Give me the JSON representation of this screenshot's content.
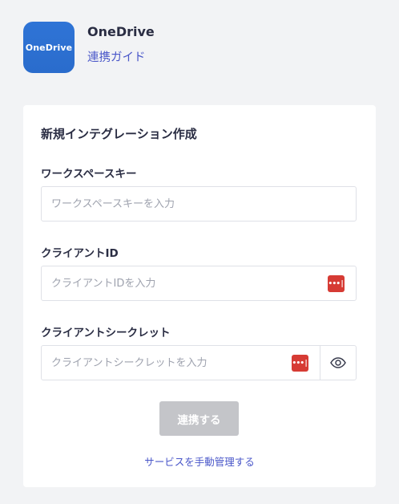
{
  "app": {
    "logo_text": "OneDrive",
    "name": "OneDrive",
    "guide_link": "連携ガイド",
    "colors": {
      "logo_bg": "#2f74d6",
      "link": "#4a57c9"
    }
  },
  "form": {
    "title": "新規インテグレーション作成",
    "workspace_key": {
      "label": "ワークスペースキー",
      "placeholder": "ワークスペースキーを入力",
      "value": ""
    },
    "client_id": {
      "label": "クライアントID",
      "placeholder": "クライアントIDを入力",
      "value": "",
      "password_manager_icon": "password-manager-icon"
    },
    "client_secret": {
      "label": "クライアントシークレット",
      "placeholder": "クライアントシークレットを入力",
      "value": "",
      "password_manager_icon": "password-manager-icon",
      "toggle_icon": "eye-icon"
    },
    "submit_label": "連携する",
    "manual_link": "サービスを手動管理する",
    "colors": {
      "password_manager": "#d63b34",
      "disabled_button": "#c4c5c9"
    }
  }
}
